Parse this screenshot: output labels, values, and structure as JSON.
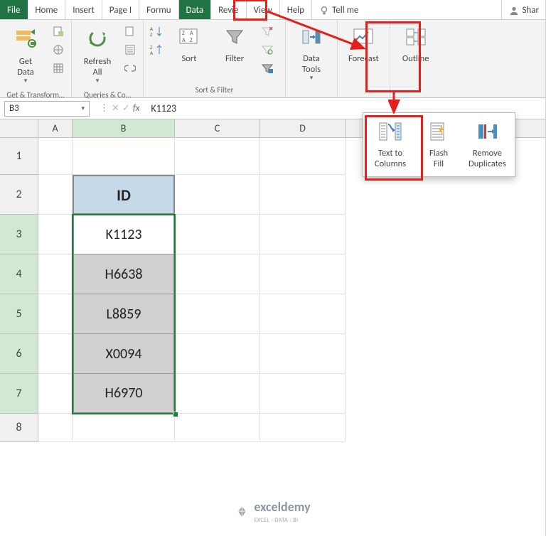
{
  "tabs": {
    "file": "File",
    "home": "Home",
    "insert": "Insert",
    "page": "Page I",
    "formulas": "Formu",
    "data": "Data",
    "review": "Revie",
    "view": "View",
    "help": "Help",
    "tellme": "Tell me",
    "share": "Shar"
  },
  "ribbon": {
    "get_data": "Get\nData",
    "get_data_drop": "▾",
    "group_get": "Get & Transform…",
    "refresh": "Refresh\nAll",
    "refresh_drop": "▾",
    "group_queries": "Queries & Co…",
    "sort": "Sort",
    "filter": "Filter",
    "group_sort": "Sort & Filter",
    "data_tools": "Data\nTools",
    "data_tools_drop": "▾",
    "forecast": "Forecast",
    "outline": "Outline"
  },
  "formula_bar": {
    "name_box": "B3",
    "fx": "fx",
    "value": "K1123"
  },
  "columns": [
    "A",
    "B",
    "C",
    "D"
  ],
  "row_numbers": [
    "1",
    "2",
    "3",
    "4",
    "5",
    "6",
    "7",
    "8"
  ],
  "table": {
    "header": "ID",
    "rows": [
      "K1123",
      "H6638",
      "L8859",
      "X0094",
      "H6970"
    ]
  },
  "popover": {
    "text_to_columns": "Text to\nColumns",
    "flash_fill": "Flash\nFill",
    "remove_dupes": "Remove\nDuplicates"
  },
  "watermark": {
    "brand": "exceldemy",
    "tag": "EXCEL · DATA · BI"
  },
  "icons": {
    "lightbulb": "lightbulb-icon",
    "person": "person-icon"
  }
}
